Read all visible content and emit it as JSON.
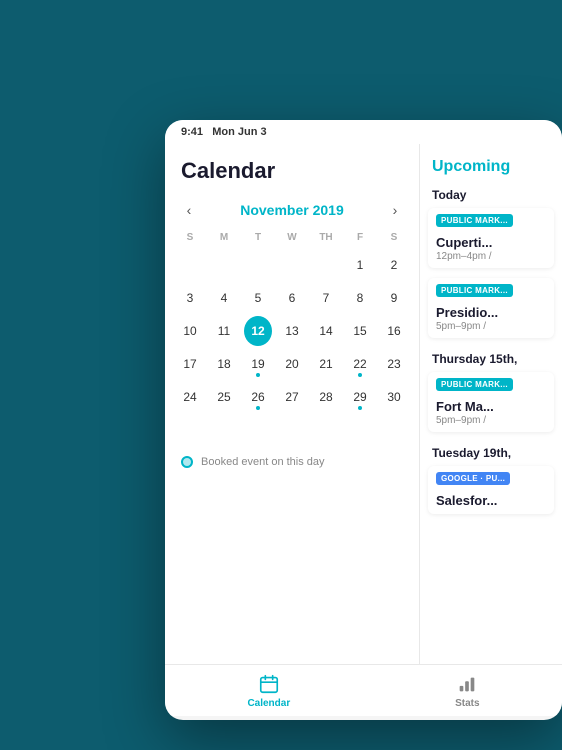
{
  "status_bar": {
    "time": "9:41",
    "date": "Mon Jun 3"
  },
  "calendar": {
    "title": "Calendar",
    "month": "November 2019",
    "day_headers": [
      "S",
      "M",
      "T",
      "W",
      "TH",
      "F",
      "S"
    ],
    "weeks": [
      [
        "",
        "",
        "",
        "",
        "",
        "1",
        "2",
        "3"
      ],
      [
        "4",
        "5",
        "6",
        "7",
        "8",
        "9",
        "10"
      ],
      [
        "11",
        "12",
        "13",
        "14",
        "15",
        "16",
        "17"
      ],
      [
        "18",
        "19",
        "20",
        "21",
        "22",
        "23",
        "24"
      ],
      [
        "25",
        "26",
        "27",
        "28",
        "29",
        "30",
        ""
      ]
    ],
    "today": "12",
    "has_events": [
      "19",
      "26",
      "29"
    ],
    "legend_label": "Booked event on this day"
  },
  "upcoming": {
    "title": "Upcoming",
    "sections": [
      {
        "date_label": "Today",
        "events": [
          {
            "badge": "PUBLIC MARK...",
            "badge_type": "teal",
            "name": "Cuperti...",
            "time": "12pm–4pm /"
          },
          {
            "badge": "PUBLIC MARK...",
            "badge_type": "teal",
            "name": "Presidio...",
            "time": "5pm–9pm /"
          }
        ]
      },
      {
        "date_label": "Thursday 15th,",
        "events": [
          {
            "badge": "PUBLIC MARK...",
            "badge_type": "teal",
            "name": "Fort Ma...",
            "time": "5pm–9pm /"
          }
        ]
      },
      {
        "date_label": "Tuesday 19th,",
        "events": [
          {
            "badge": "GOOGLE · PU...",
            "badge_type": "google",
            "name": "Salesfor...",
            "time": ""
          }
        ]
      }
    ]
  },
  "tabs": [
    {
      "label": "Calendar",
      "active": true
    },
    {
      "label": "Stats",
      "active": false
    }
  ]
}
